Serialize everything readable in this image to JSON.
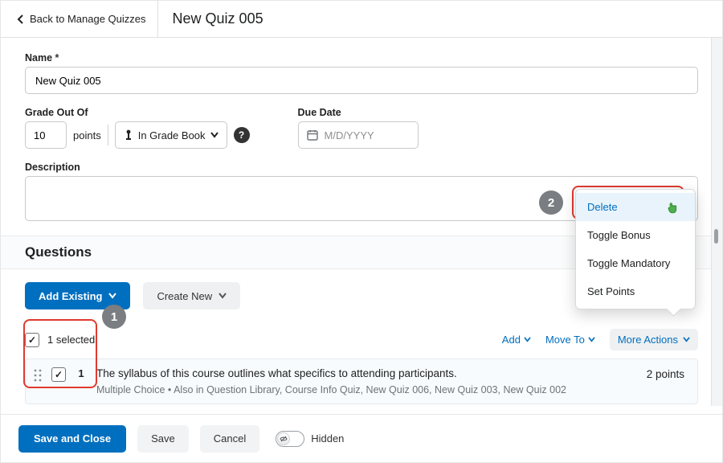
{
  "header": {
    "back_label": "Back to Manage Quizzes",
    "title": "New Quiz 005"
  },
  "name_field": {
    "label": "Name",
    "value": "New Quiz 005"
  },
  "grade": {
    "label": "Grade Out Of",
    "value": "10",
    "points_word": "points",
    "gradebook_label": "In Grade Book"
  },
  "due": {
    "label": "Due Date",
    "placeholder": "M/D/YYYY"
  },
  "description": {
    "label": "Description"
  },
  "questions": {
    "heading": "Questions",
    "add_existing": "Add Existing",
    "create_new": "Create New",
    "selected_text": "1 selected",
    "add_label": "Add",
    "move_to_label": "Move To",
    "more_actions_label": "More Actions",
    "item": {
      "number": "1",
      "title": "The syllabus of this course outlines what specifics to attending participants.",
      "meta": "Multiple Choice  •  Also in Question Library, Course Info Quiz, New Quiz 006, New Quiz 003, New Quiz 002",
      "points": "2 points"
    }
  },
  "menu": {
    "delete": "Delete",
    "toggle_bonus": "Toggle Bonus",
    "toggle_mandatory": "Toggle Mandatory",
    "set_points": "Set Points"
  },
  "footer": {
    "save_close": "Save and Close",
    "save": "Save",
    "cancel": "Cancel",
    "hidden": "Hidden"
  },
  "annotations": {
    "one": "1",
    "two": "2"
  }
}
